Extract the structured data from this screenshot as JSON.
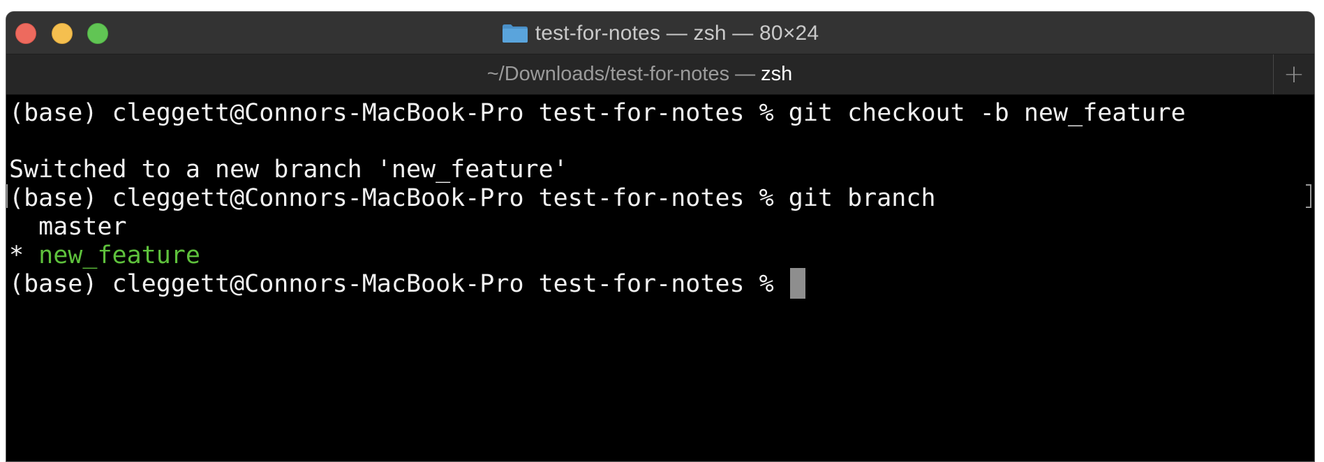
{
  "window": {
    "title": "test-for-notes — zsh — 80×24",
    "folder_icon": "folder-icon",
    "controls": {
      "close": "close-icon",
      "minimize": "minimize-icon",
      "maximize": "maximize-icon"
    }
  },
  "tab": {
    "path": "~/Downloads/test-for-notes —",
    "shell": "zsh",
    "new_tab_label": "+"
  },
  "terminal": {
    "lines": [
      {
        "text": "(base) cleggett@Connors-MacBook-Pro test-for-notes % git checkout -b new_feature"
      },
      {
        "text": ""
      },
      {
        "text": "Switched to a new branch 'new_feature'"
      },
      {
        "text": "(base) cleggett@Connors-MacBook-Pro test-for-notes % git branch"
      },
      {
        "text": "  master"
      },
      {
        "marker": "* ",
        "branch": "new_feature"
      },
      {
        "prompt": "(base) cleggett@Connors-MacBook-Pro test-for-notes % "
      }
    ]
  },
  "colors": {
    "background": "#000000",
    "text": "#f2f2f2",
    "current_branch": "#5ec13c",
    "cursor": "#8e8e8e",
    "titlebar": "#333333",
    "tabbar": "#262626"
  }
}
